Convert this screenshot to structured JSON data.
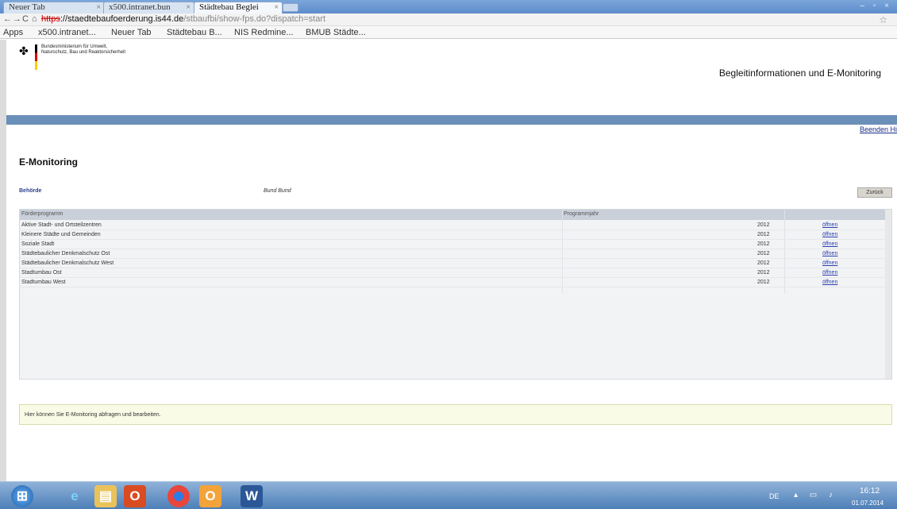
{
  "browser": {
    "tabs": [
      {
        "label": "Neuer Tab",
        "close": "×"
      },
      {
        "label": "x500.intranet.bun",
        "close": "×"
      },
      {
        "label": "Städtebau Beglei",
        "close": "×"
      }
    ],
    "window_controls": "– ▫ ×",
    "nav": {
      "back": "←",
      "forward": "→",
      "reload": "C",
      "home": "⌂"
    },
    "url": {
      "scheme": "https",
      "rest_host": "://staedtebaufoerderung.is44.de",
      "path": "/stbaufbi/show-fps.do?dispatch=start"
    },
    "star": "☆",
    "bookmarks": [
      "Apps",
      "x500.intranet...",
      "Neuer Tab",
      "Städtebau B...",
      "NIS Redmine...",
      "BMUB Städte..."
    ]
  },
  "header": {
    "logo_text": "Bundesministerium für Umwelt, Naturschutz, Bau und Reaktorsicherheit",
    "app_title": "Begleitinformationen und E-Monitoring",
    "beenden_link": "Beenden Hi"
  },
  "main": {
    "section_title": "E-Monitoring",
    "behoerde_label": "Behörde",
    "behoerde_value": "Bund Bund",
    "back_button": "Zurück",
    "table": {
      "columns": [
        "Förderprogramm",
        "Programmjahr",
        ""
      ],
      "rows": [
        {
          "program": "Aktive Stadt- und Ortsteilzentren",
          "year": "2012",
          "action": "öffnen"
        },
        {
          "program": "Kleinere Städte und Gemeinden",
          "year": "2012",
          "action": "öffnen"
        },
        {
          "program": "Soziale Stadt",
          "year": "2012",
          "action": "öffnen"
        },
        {
          "program": "Städtebaulicher Denkmalschutz Ost",
          "year": "2012",
          "action": "öffnen"
        },
        {
          "program": "Städtebaulicher Denkmalschutz West",
          "year": "2012",
          "action": "öffnen"
        },
        {
          "program": "Stadtumbau Ost",
          "year": "2012",
          "action": "öffnen"
        },
        {
          "program": "Stadtumbau West",
          "year": "2012",
          "action": "öffnen"
        }
      ]
    },
    "info_text": "Hier können Sie E-Monitoring abfragen und bearbeiten."
  },
  "taskbar": {
    "language": "DE",
    "time": "16:12",
    "date": "01.07.2014"
  }
}
